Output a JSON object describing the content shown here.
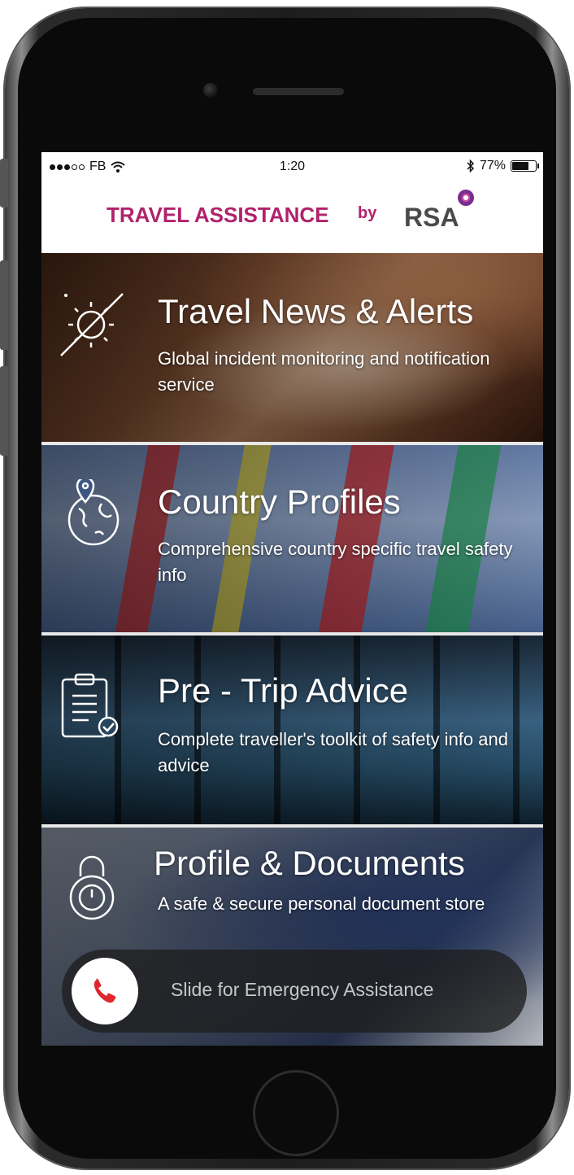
{
  "status_bar": {
    "carrier": "FB",
    "time": "1:20",
    "battery": "77%",
    "battery_level": 0.77
  },
  "header": {
    "title": "TRAVEL ASSISTANCE",
    "by": "by",
    "logo": "RSA"
  },
  "tiles": [
    {
      "title": "Travel News & Alerts",
      "subtitle": "Global incident monitoring and notification service",
      "icon": "sun-slash-icon"
    },
    {
      "title": "Country Profiles",
      "subtitle": "Comprehensive country specific travel safety info",
      "icon": "globe-pin-icon"
    },
    {
      "title": "Pre - Trip Advice",
      "subtitle": "Complete traveller's toolkit of safety info and advice",
      "icon": "clipboard-check-icon"
    },
    {
      "title": "Profile & Documents",
      "subtitle": "A safe & secure personal document store",
      "icon": "padlock-icon"
    }
  ],
  "emergency": {
    "label": "Slide for Emergency Assistance",
    "icon": "phone-icon",
    "icon_color": "#e0262e"
  },
  "colors": {
    "brand": "#b0226b"
  }
}
